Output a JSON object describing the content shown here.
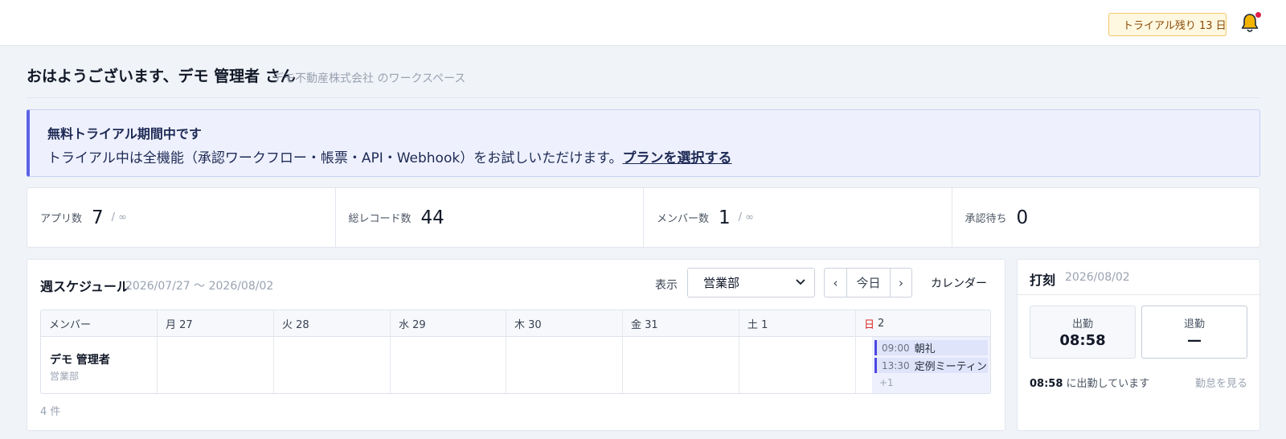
{
  "header": {
    "trial_badge": "トライアル残り 13 日",
    "accent": "#f0a020"
  },
  "greeting": {
    "title": "おはようございます、デモ 管理者 さん",
    "workspace": "デモ不動産株式会社 のワークスペース"
  },
  "banner": {
    "title": "無料トライアル期間中です",
    "text": "トライアル中は全機能（承認ワークフロー・帳票・API・Webhook）をお試しいただけます。",
    "link": "プランを選択する",
    "accent": "#5a63e6"
  },
  "stats": [
    {
      "label": "アプリ数",
      "value": "7",
      "suffix": "/ ∞"
    },
    {
      "label": "総レコード数",
      "value": "44",
      "suffix": ""
    },
    {
      "label": "メンバー数",
      "value": "1",
      "suffix": "/ ∞"
    },
    {
      "label": "承認待ち",
      "value": "0",
      "suffix": ""
    }
  ],
  "schedule": {
    "title": "週スケジュール",
    "range": "2026/07/27 〜 2026/08/02",
    "display_label": "表示",
    "department": "営業部",
    "prev": "‹",
    "today": "今日",
    "next": "›",
    "calendar_button": "カレンダー",
    "columns": [
      "メンバー",
      "月 27",
      "火 28",
      "水 29",
      "木 30",
      "金 31",
      "土 1"
    ],
    "sunday": {
      "day": "日",
      "date": "2"
    },
    "member": {
      "name": "デモ 管理者",
      "dept": "営業部"
    },
    "events": [
      {
        "time": "09:00",
        "title": "朝礼"
      },
      {
        "time": "13:30",
        "title": "定例ミーティング"
      }
    ],
    "more": "+1",
    "count": "4 件"
  },
  "punch": {
    "title": "打刻",
    "date": "2026/08/02",
    "in_label": "出勤",
    "in_value": "08:58",
    "out_label": "退勤",
    "out_value": "—",
    "status_time": "08:58",
    "status_text": " に出勤しています",
    "link": "勤怠を見る"
  }
}
